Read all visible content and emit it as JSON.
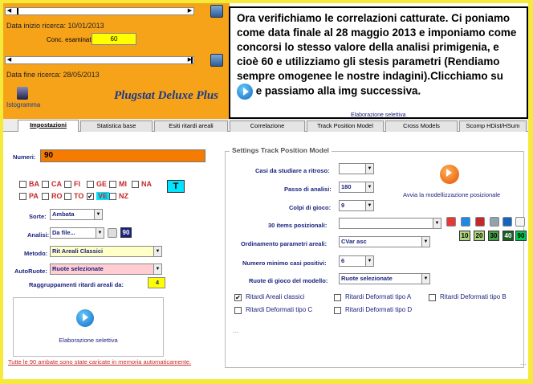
{
  "top": {
    "data_inizio_label": "Data inizio ricerca:",
    "data_inizio": "10/01/2013",
    "conc_label": "Conc. esaminati",
    "conc_value": "60",
    "data_fine_label": "Data fine ricerca:",
    "data_fine": "28/05/2013",
    "histogram_label": "Istogramma",
    "brand": "Plugstat Deluxe Plus"
  },
  "note": {
    "text_before": "Ora verifichiamo le correlazioni catturate. Ci poniamo come data finale al 28 maggio 2013 e imponiamo come concorsi lo stesso valore della analisi primigenia, e cioè 60  e utilizziamo gli stesis parametri (Rendiamo sempre omogenee le nostre indagini).Clicchiamo su",
    "text_after": "e passiamo alla img successiva.",
    "button_caption": "Elaborazione selettiva"
  },
  "tabs": [
    "Impostazioni",
    "Statistica base",
    "Esiti ritardi areali",
    "Correlazione",
    "Track Position Model",
    "Cross Models",
    "Scomp HDist/HSum"
  ],
  "left": {
    "numeri_label": "Numeri:",
    "numeri_value": "90",
    "wheels_row1": [
      "BA",
      "CA",
      "FI",
      "GE",
      "MI",
      "NA"
    ],
    "wheels_row2": [
      "PA",
      "RO",
      "TO",
      "VE",
      "NZ"
    ],
    "t_button": "T",
    "sorte_label": "Sorte:",
    "sorte_value": "Ambata",
    "analisi_label": "Analisi:",
    "analisi_value": "Da file...",
    "analisi_count": "90",
    "metodo_label": "Metodo:",
    "metodo_value": "Rit Areali Classici",
    "autoruote_label": "AutoRuote:",
    "autoruote_value": "Ruote selezionate",
    "raggr_label": "Raggruppamenti ritardi areali da:",
    "raggr_value": "4",
    "elab_label": "Elaborazione selettiva",
    "footer": "Tutte le 90 ambate sono state caricate in memoria automaticamente."
  },
  "right": {
    "title": "Settings Track Position Model",
    "casi_label": "Casi da studiare a ritroso:",
    "casi_value": "",
    "passo_label": "Passo di analisi:",
    "passo_value": "180",
    "colpi_label": "Colpi di gioco:",
    "colpi_value": "9",
    "items_label": "30 items posizionali:",
    "items_value": "",
    "ord_label": "Ordinamento parametri areali:",
    "ord_value": "CVar asc",
    "min_label": "Numero minimo casi positivi:",
    "min_value": "6",
    "ruote_label": "Ruote di gioco del modello:",
    "ruote_value": "Ruote selezionate",
    "avvia_label": "Avvia la modellizzazione posizionale",
    "nums": [
      "10",
      "20",
      "30",
      "40",
      "90"
    ],
    "checks": [
      "Ritardi Areali classici",
      "Ritardi Deformati tipo A",
      "Ritardi Deformati tipo B",
      "Ritardi Deformati tipo C",
      "Ritardi Deformati tipo D"
    ],
    "dots": "...",
    "dots2": "..."
  },
  "colors": {
    "top_bg": "#f7a31a",
    "numeri_bg": "#f57c00",
    "accent_blue": "#1a237e",
    "frame": "#f5e93a"
  }
}
